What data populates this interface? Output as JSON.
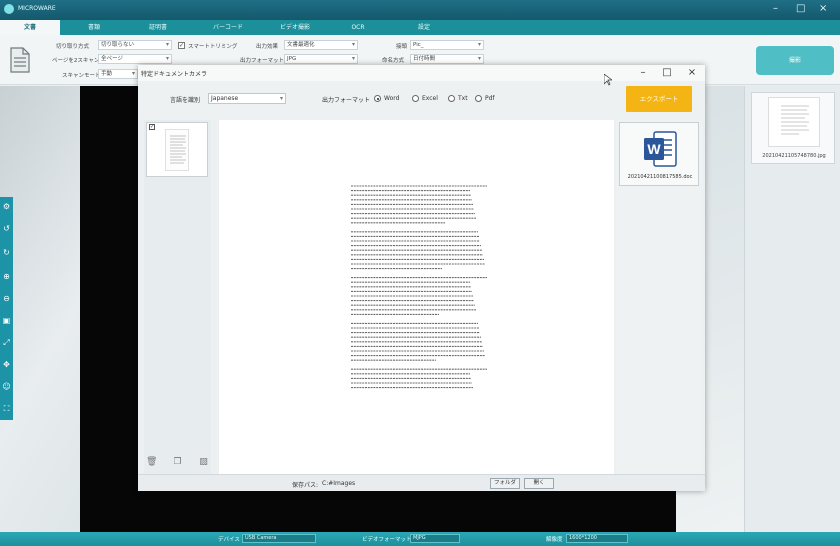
{
  "app": {
    "title": "MICROWARE",
    "window_controls": [
      "–",
      "□",
      "×"
    ]
  },
  "tabs": [
    "文書",
    "書類",
    "証明書",
    "バーコード",
    "ビデオ撮影",
    "OCR",
    "設定"
  ],
  "ribbon": {
    "crop_label": "切り取り方式",
    "crop_value": "切り取らない",
    "smart_trim_label": "スマートトリミング",
    "page_scan_label": "ページを2スキャン",
    "page_scan_value": "全ページ",
    "scan_mode_label": "スキャンモード",
    "scan_mode_value": "手動",
    "output_effect_label": "出力効果",
    "output_effect_value": "文書最適化",
    "output_format_label": "出力フォーマット",
    "output_format_value": "JPG",
    "prefix_label": "接頭",
    "prefix_value": "Pic_",
    "naming_label": "命名方式",
    "naming_value": "日付時間",
    "scan_button": "撮影"
  },
  "thumbnail": {
    "filename": "20210421105748780.jpg"
  },
  "dialog": {
    "title": "特定ドキュメントカメラ",
    "language_label": "言語を識別",
    "language_value": "Japanese",
    "output_format_label": "出力フォーマット",
    "formats": [
      {
        "label": "Word",
        "selected": true
      },
      {
        "label": "Excel",
        "selected": false
      },
      {
        "label": "Txt",
        "selected": false
      },
      {
        "label": "Pdf",
        "selected": false
      }
    ],
    "export_button": "エクスポート",
    "output_file": "20210421100817585.doc",
    "save_path_label": "保存パス:",
    "save_path_value": "C:#Images",
    "browse_button": "フォルダ",
    "open_button": "開く",
    "page_check": "✓"
  },
  "statusbar": {
    "device_label": "デバイス",
    "device_value": "USB Camera",
    "video_format_label": "ビデオフォーマット",
    "video_format_value": "MJPG",
    "resolution_label": "解像度",
    "resolution_value": "1600*1200"
  },
  "colors": {
    "accent": "#1b8f9a",
    "export": "#f4b414",
    "word": "#2b579a"
  }
}
